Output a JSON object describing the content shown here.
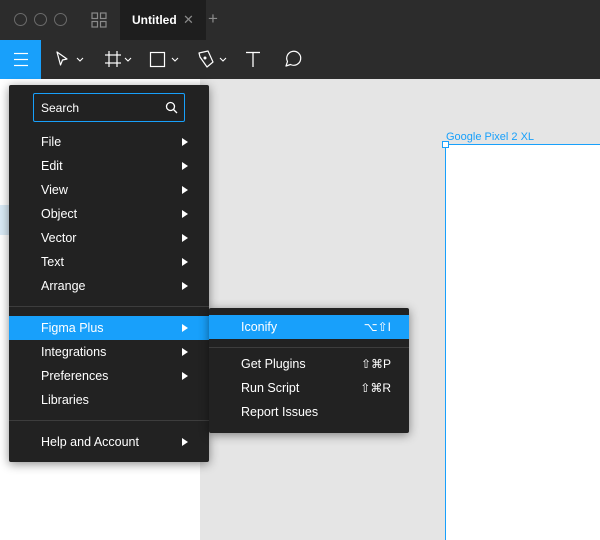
{
  "tab": {
    "title": "Untitled",
    "close_glyph": "✕",
    "add_glyph": "+"
  },
  "colors": {
    "accent": "#18a0fb",
    "menu_bg": "#222222",
    "toolbar_bg": "#2c2c2c"
  },
  "icons": [
    "hamburger-menu-icon",
    "move-tool-icon",
    "frame-tool-icon",
    "rectangle-tool-icon",
    "pen-tool-icon",
    "text-tool-icon",
    "comment-tool-icon",
    "search-icon"
  ],
  "canvas": {
    "frame_label": "Google Pixel 2 XL"
  },
  "main_menu": {
    "search_placeholder": "Search",
    "items": [
      {
        "label": "File",
        "submenu": true
      },
      {
        "label": "Edit",
        "submenu": true
      },
      {
        "label": "View",
        "submenu": true
      },
      {
        "label": "Object",
        "submenu": true
      },
      {
        "label": "Vector",
        "submenu": true
      },
      {
        "label": "Text",
        "submenu": true
      },
      {
        "label": "Arrange",
        "submenu": true
      }
    ],
    "plugin_items": [
      {
        "label": "Figma Plus",
        "submenu": true,
        "highlighted": true
      },
      {
        "label": "Integrations",
        "submenu": true
      },
      {
        "label": "Preferences",
        "submenu": true
      },
      {
        "label": "Libraries",
        "submenu": false
      }
    ],
    "help_item": {
      "label": "Help and Account",
      "submenu": true
    }
  },
  "sub_menu": {
    "items": [
      {
        "label": "Iconify",
        "shortcut": "⌥⇧I",
        "highlighted": true
      },
      {
        "label": "Get Plugins",
        "shortcut": "⇧⌘P"
      },
      {
        "label": "Run Script",
        "shortcut": "⇧⌘R"
      },
      {
        "label": "Report Issues",
        "shortcut": ""
      }
    ]
  }
}
